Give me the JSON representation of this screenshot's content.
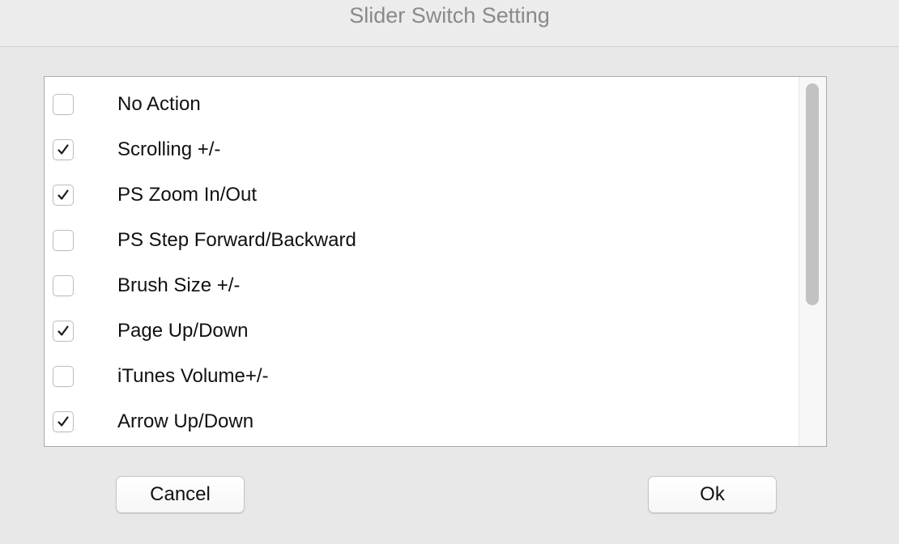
{
  "window": {
    "title": "Slider Switch Setting"
  },
  "options": [
    {
      "label": "No Action",
      "checked": false
    },
    {
      "label": "Scrolling +/-",
      "checked": true
    },
    {
      "label": "PS Zoom In/Out",
      "checked": true
    },
    {
      "label": "PS Step Forward/Backward",
      "checked": false
    },
    {
      "label": "Brush Size +/-",
      "checked": false
    },
    {
      "label": "Page Up/Down",
      "checked": true
    },
    {
      "label": "iTunes Volume+/-",
      "checked": false
    },
    {
      "label": "Arrow Up/Down",
      "checked": true
    }
  ],
  "buttons": {
    "cancel_label": "Cancel",
    "ok_label": "Ok"
  },
  "icons": {
    "check": "checkmark-icon"
  },
  "colors": {
    "window_background": "#e8e8e8",
    "list_background": "#ffffff",
    "title_text": "#8a8a8a",
    "scroll_thumb": "#c2c2c2"
  }
}
